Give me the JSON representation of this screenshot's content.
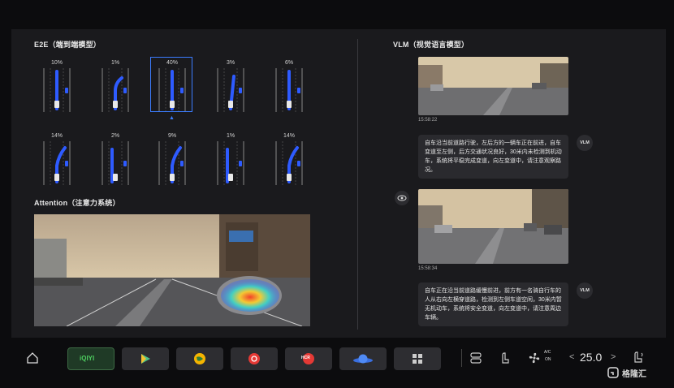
{
  "e2e": {
    "title": "E2E（端到端模型）",
    "row1": [
      "10%",
      "1%",
      "40%",
      "3%",
      "6%"
    ],
    "row2": [
      "14%",
      "2%",
      "9%",
      "1%",
      "14%"
    ]
  },
  "attention": {
    "title": "Attention（注意力系统）"
  },
  "vlm": {
    "title": "VLM（视觉语言模型）",
    "badge": "VLM",
    "messages": [
      {
        "time": "15:58:22",
        "text": "自车沿当前道路行驶，左后方的一辆车正在前进，自车变道至左侧，后方交通状况良好，30米内未检测到机动车，系统将平稳完成变道，向左变道中，请注意观察路况。"
      },
      {
        "time": "15:58:34",
        "text": "自车正在沿当前道路缓慢前进，前方有一名骑自行车的人从右向左横穿道路，检测到左侧车道空闲，30米内暂无机动车，系统将安全变道，向左变道中，请注意周边车辆。"
      }
    ]
  },
  "dock": {
    "apps": [
      "iQIYI",
      "HCR"
    ],
    "ac_label": "A/C",
    "ac_state": "ON",
    "temp": "25.0",
    "temp_left": "<",
    "temp_right": ">"
  },
  "watermark": "格隆汇",
  "colors": {
    "accent": "#3b7cff",
    "path": "#2e5bff"
  }
}
